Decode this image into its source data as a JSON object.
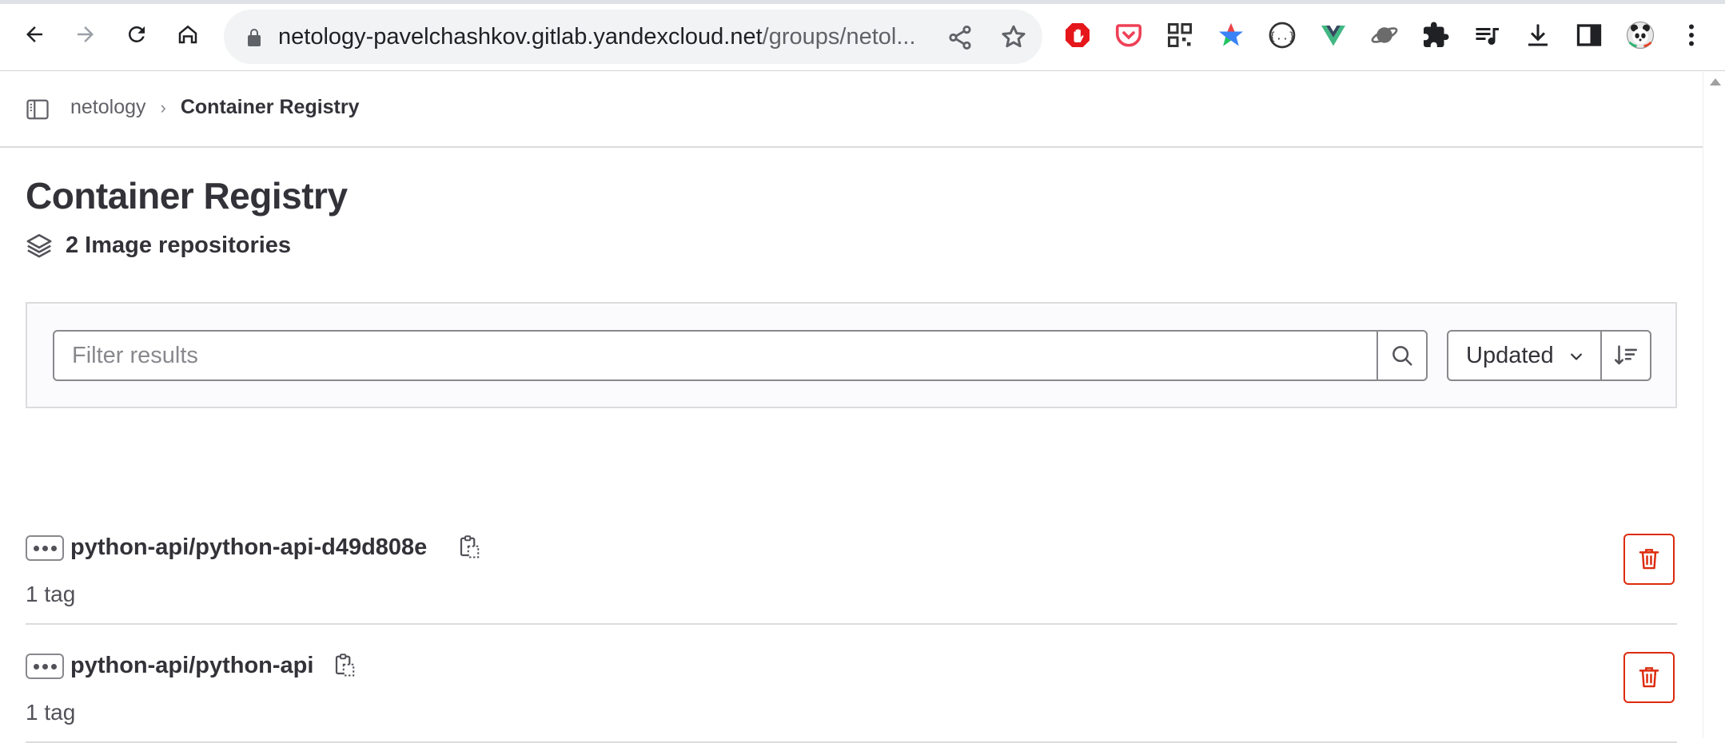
{
  "browser": {
    "url_host": "netology-pavelchashkov.gitlab.yandexcloud.net",
    "url_path": "/groups/netol..."
  },
  "breadcrumb": {
    "parent": "netology",
    "current": "Container Registry"
  },
  "page": {
    "title": "Container Registry",
    "repo_count": "2 Image repositories"
  },
  "filter": {
    "placeholder": "Filter results",
    "sort_label": "Updated"
  },
  "repositories": [
    {
      "name": "python-api/python-api-d49d808e",
      "tags": "1 tag"
    },
    {
      "name": "python-api/python-api",
      "tags": "1 tag"
    }
  ],
  "colors": {
    "danger": "#dd2b0e",
    "text": "#333238",
    "muted": "#626168",
    "border": "#dcdcde"
  }
}
